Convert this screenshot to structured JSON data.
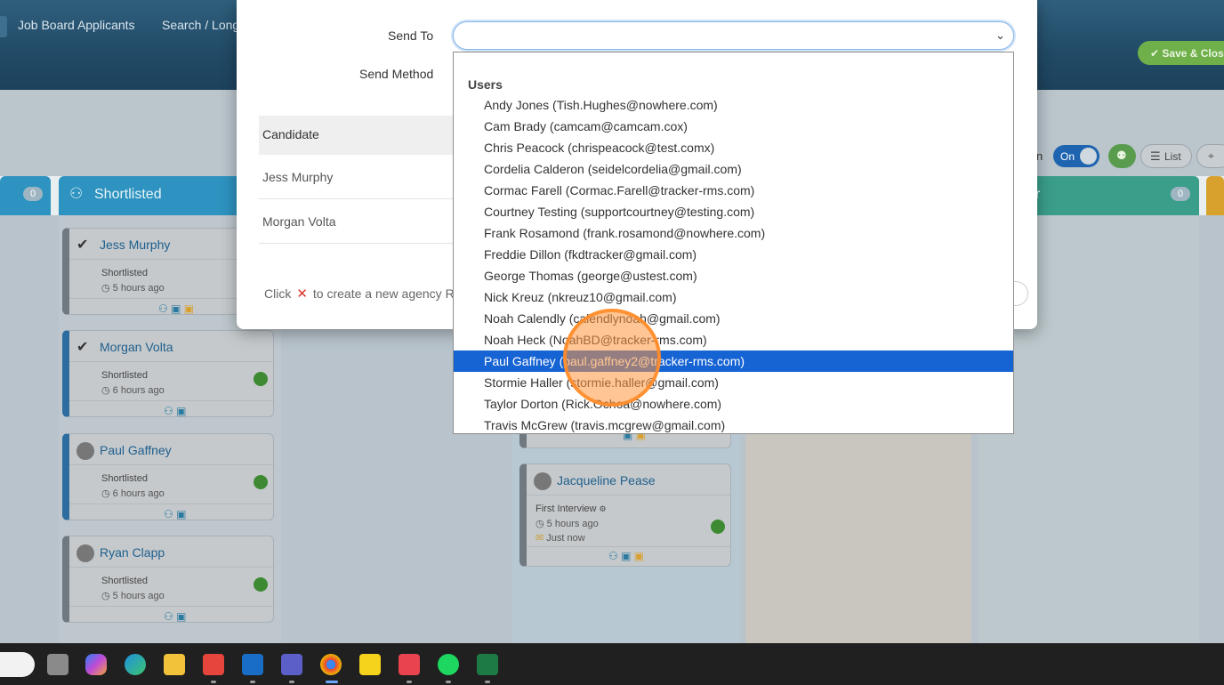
{
  "nav": {
    "item1": "Job Board Applicants",
    "item2": "Search / Long",
    "save_close": "✔ Save & Close"
  },
  "board": {
    "col1_count": "0",
    "col2_title": "Shortlisted",
    "col_right_count": "0",
    "col_right_title_fragment": "r",
    "toggle_label": "On",
    "toolbar_partial": "n",
    "list_label": "List"
  },
  "cards": [
    {
      "name": "Jess Murphy",
      "status": "Shortlisted",
      "time": "5 hours ago"
    },
    {
      "name": "Morgan Volta",
      "status": "Shortlisted",
      "time": "6 hours ago"
    },
    {
      "name": "Paul Gaffney",
      "status": "Shortlisted",
      "time": "6 hours ago"
    },
    {
      "name": "Ryan Clapp",
      "status": "Shortlisted",
      "time": "5 hours ago"
    },
    {
      "name": "Jacqueline Pease",
      "status": "First Interview",
      "time": "5 hours ago",
      "extra": "Just now"
    }
  ],
  "modal": {
    "send_to_label": "Send To",
    "send_method_label": "Send Method",
    "table_header": "Candidate",
    "rows": [
      "Jess Murphy",
      "Morgan Volta"
    ],
    "hint_before": "Click",
    "hint_after": "to create a new agency R"
  },
  "dropdown": {
    "group": "Users",
    "items": [
      "Andy Jones (Tish.Hughes@nowhere.com)",
      "Cam Brady (camcam@camcam.cox)",
      "Chris Peacock (chrispeacock@test.comx)",
      "Cordelia Calderon (seidelcordelia@gmail.com)",
      "Cormac Farell (Cormac.Farell@tracker-rms.com)",
      "Courtney Testing (supportcourtney@testing.com)",
      "Frank Rosamond (frank.rosamond@nowhere.com)",
      "Freddie Dillon (fkdtracker@gmail.com)",
      "George Thomas (george@ustest.com)",
      "Nick Kreuz (nkreuz10@gmail.com)",
      "Noah Calendly (calendlynoah@gmail.com)",
      "Noah Heck (NoahBD@tracker-rms.com)",
      "Paul Gaffney (paul.gaffney2@tracker-rms.com)",
      "Stormie Haller (stormie.haller@gmail.com)",
      "Taylor Dorton (Rick.Ochoa@nowhere.com)",
      "Travis McGrew (travis.mcgrew@gmail.com)"
    ],
    "selected_index": 12
  },
  "colors": {
    "selected": "#1663d4",
    "accent_green": "#6fb04b",
    "hint_x": "#d9342b"
  }
}
